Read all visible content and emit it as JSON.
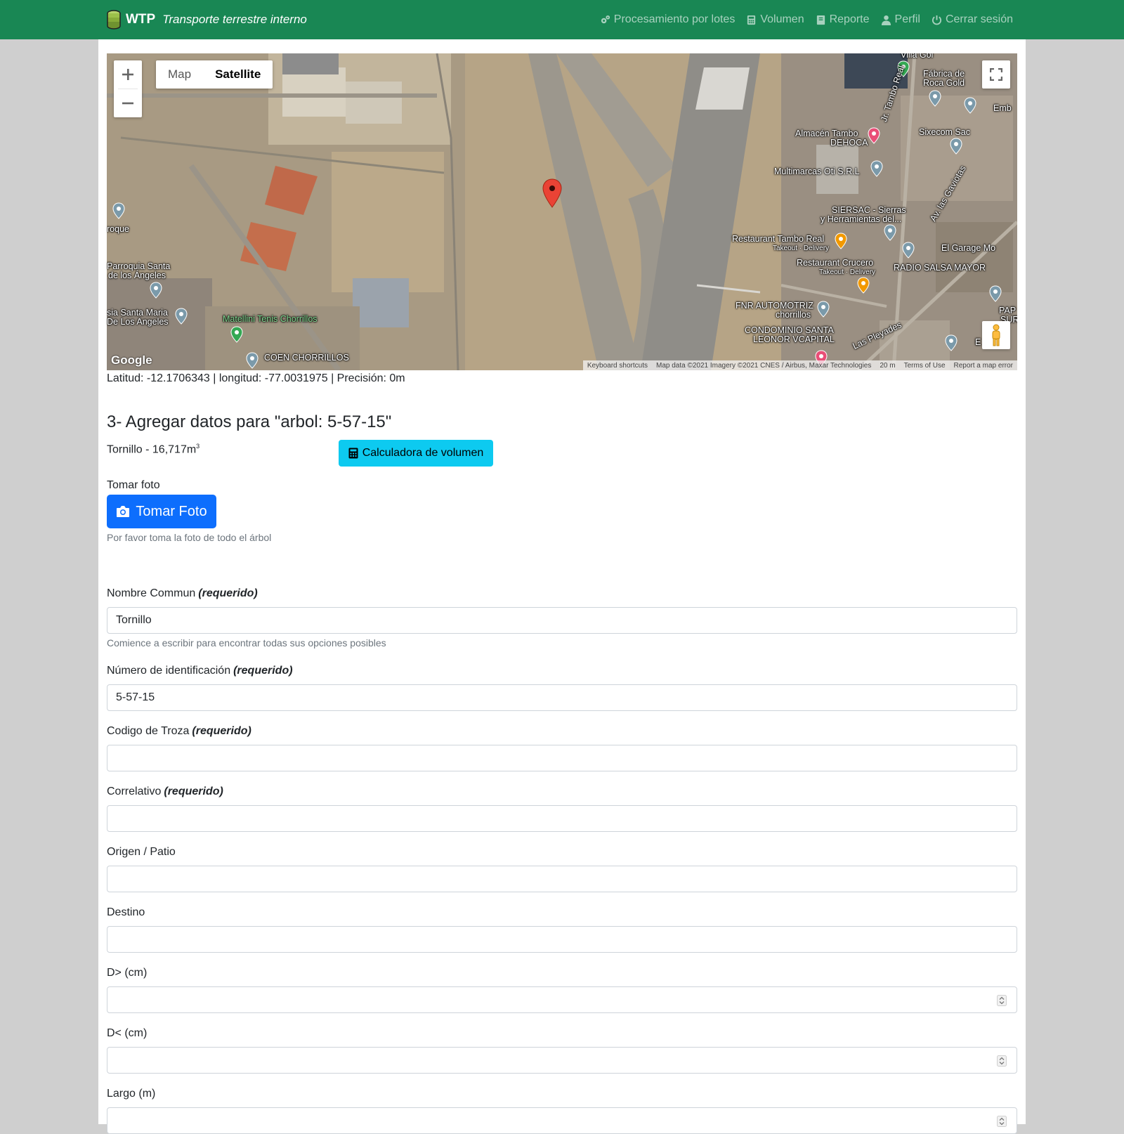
{
  "navbar": {
    "brand": "WTP",
    "subtitle": "Transporte terrestre interno",
    "links": [
      {
        "label": "Procesamiento por lotes",
        "icon": "gears-icon"
      },
      {
        "label": "Volumen",
        "icon": "calculator-icon"
      },
      {
        "label": "Reporte",
        "icon": "book-icon"
      },
      {
        "label": "Perfil",
        "icon": "user-icon"
      },
      {
        "label": "Cerrar sesión",
        "icon": "power-icon"
      }
    ]
  },
  "map": {
    "type_buttons": [
      "Map",
      "Satellite"
    ],
    "active_type": "Satellite",
    "labels": [
      "Villa Gol",
      "Fábrica de",
      "Roca Gold",
      "Emb",
      "Almacén Tambo",
      "DEHOCA",
      "Jr. Tambo Real",
      "Sixecom Sac",
      "Multimarcas Oti S.R.L",
      "Av. las Gaviotas",
      "SIERSAC - Sierras",
      "y Herramientas del...",
      "Restaurant Tambo Real",
      "Takeout · Delivery",
      "El Garage Mo",
      "Restaurant Crucero",
      "Takeout · Delivery",
      "RADIO SALSA MAYOR",
      "FNR AUTOMOTRIZ",
      "chorrillos",
      "CONDOMINIO SANTA",
      "LEONOR VCAPITAL",
      "Las Pleyades",
      "PAP",
      "SURA",
      "E",
      "roque",
      "Parroquia Santa",
      "de los Ángeles",
      "sia Santa Maria",
      "De Los Angeles",
      "Matellini Tenis Chorrillos",
      "COEN CHORRILLOS"
    ],
    "attribution": [
      "Keyboard shortcuts",
      "Map data ©2021 Imagery ©2021 CNES / Airbus, Maxar Technologies",
      "20 m",
      "Terms of Use",
      "Report a map error"
    ],
    "google": "Google"
  },
  "coords_text": "Latitud: -12.1706343 | longitud: -77.0031975 | Precisión: 0m",
  "section_title": "3- Agregar datos para \"arbol: 5-57-15\"",
  "species_text": "Tornillo - 16,717m",
  "species_sup": "3",
  "calc_button": "Calculadora de volumen",
  "photo": {
    "label": "Tomar foto",
    "button": "Tomar Foto",
    "help": "Por favor toma la foto de todo el árbol"
  },
  "required_tag": "(requerido)",
  "fields": {
    "nombre": {
      "label": "Nombre Commun",
      "value": "Tornillo",
      "help": "Comience a escribir para encontrar todas sus opciones posibles"
    },
    "numero": {
      "label": "Número de identificación",
      "value": "5-57-15"
    },
    "codigo": {
      "label": "Codigo de Troza",
      "value": ""
    },
    "correlativo": {
      "label": "Correlativo",
      "value": ""
    },
    "origen": {
      "label": "Origen / Patio",
      "value": ""
    },
    "destino": {
      "label": "Destino",
      "value": ""
    },
    "dmayor": {
      "label": "D> (cm)",
      "value": ""
    },
    "dmenor": {
      "label": "D< (cm)",
      "value": ""
    },
    "largo": {
      "label": "Largo (m)",
      "value": ""
    }
  },
  "colors": {
    "navbar": "#198754",
    "info_button": "#0dcaf0",
    "primary_button": "#0d6efd"
  }
}
